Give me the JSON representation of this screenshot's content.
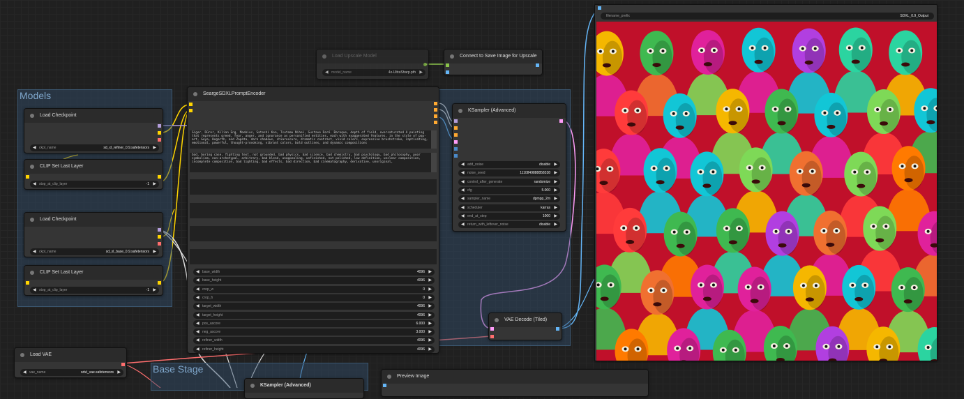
{
  "groups": {
    "models": "Models",
    "base_stage": "Base Stage"
  },
  "load_checkpoint_refiner": {
    "title": "Load Checkpoint",
    "ckpt_name_label": "ckpt_name",
    "ckpt_name_value": "sd_xl_refiner_0.9.safetensors"
  },
  "clip_set_last_layer_1": {
    "title": "CLIP Set Last Layer",
    "label": "stop_at_clip_layer",
    "value": "-1"
  },
  "load_checkpoint_base": {
    "title": "Load Checkpoint",
    "ckpt_name_label": "ckpt_name",
    "ckpt_name_value": "sd_xl_base_0.9.safetensors"
  },
  "clip_set_last_layer_2": {
    "title": "CLIP Set Last Layer",
    "label": "stop_at_clip_layer",
    "value": "-1"
  },
  "load_vae": {
    "title": "Load VAE",
    "label": "vae_name",
    "value": "sdxl_vae.safetensors"
  },
  "load_upscale_model": {
    "title": "Load Upscale Model",
    "label": "model_name",
    "value": "4x-UltraSharp.pth"
  },
  "connect_save": {
    "title": "Connect to Save Image for Upscale"
  },
  "prompt_encoder": {
    "title": "SeargeSDXLPromptEncoder",
    "positive_text": "Giger, Dürer, Kilian Eng, Moebius, Satoshi Kon, Tsutomu Nihei, Gustave Doré. Baroque, depth of field, oversaturated A painting that represents greed, fear, anger, and ignorance as personified entities, each with exaggerated features, in the style of pop-art, Goya, Hogarth, and Zapata, dark shadows, chiaroscuro, dramatic contrast, vivid colors, expressive brushstroke, captivating, emotional, powerful, thought-provoking, vibrant colors, bold outlines, and dynamic compositions",
    "negative_text": "bad, boring case, fighting text, not grounded, bad physics, bad science, bad chemistry, bad psychology, bad philosophy, poor symbolism, non-archetypal, arbitrary, bad blend, unappealing, unfinished, not polished, low definition, unclear composition, incomplete composition, bad lighting, bad effects, bad direction, bad cinematography, derivative, unoriginal,",
    "widgets": [
      {
        "name": "base_width",
        "value": "4096"
      },
      {
        "name": "base_height",
        "value": "4096"
      },
      {
        "name": "crop_w",
        "value": "0"
      },
      {
        "name": "crop_h",
        "value": "0"
      },
      {
        "name": "target_width",
        "value": "4096"
      },
      {
        "name": "target_height",
        "value": "4096"
      },
      {
        "name": "pos_ascore",
        "value": "6.000"
      },
      {
        "name": "neg_ascore",
        "value": "3.000"
      },
      {
        "name": "refiner_width",
        "value": "4096"
      },
      {
        "name": "refiner_height",
        "value": "4096"
      }
    ]
  },
  "ksampler_advanced": {
    "title": "KSampler (Advanced)",
    "widgets": [
      {
        "name": "add_noise",
        "value": "disable"
      },
      {
        "name": "noise_seed",
        "value": "1110849888858338"
      },
      {
        "name": "control_after_generate",
        "value": "randomize"
      },
      {
        "name": "cfg",
        "value": "5.000"
      },
      {
        "name": "sampler_name",
        "value": "dpmpp_2m"
      },
      {
        "name": "scheduler",
        "value": "karras"
      },
      {
        "name": "end_at_step",
        "value": "1000"
      },
      {
        "name": "return_with_leftover_noise",
        "value": "disable"
      }
    ]
  },
  "vae_decode_tiled": {
    "title": "VAE Decode (Tiled)"
  },
  "save_image": {
    "filename_prefix_label": "filename_prefix",
    "filename_prefix_value": "SDXL_0.9_Output"
  },
  "ksampler_base": {
    "title": "KSampler (Advanced)"
  },
  "preview_image": {
    "title": "Preview Image"
  },
  "colors": {
    "model_purple": "#b39ddb",
    "clip_yellow": "#ffd500",
    "vae_red": "#ff6e6e",
    "latent_pink": "#ff9cf9",
    "image_blue": "#64b5f6",
    "conditioning_orange": "#ffa931",
    "upscale_green": "#8bc34a"
  }
}
